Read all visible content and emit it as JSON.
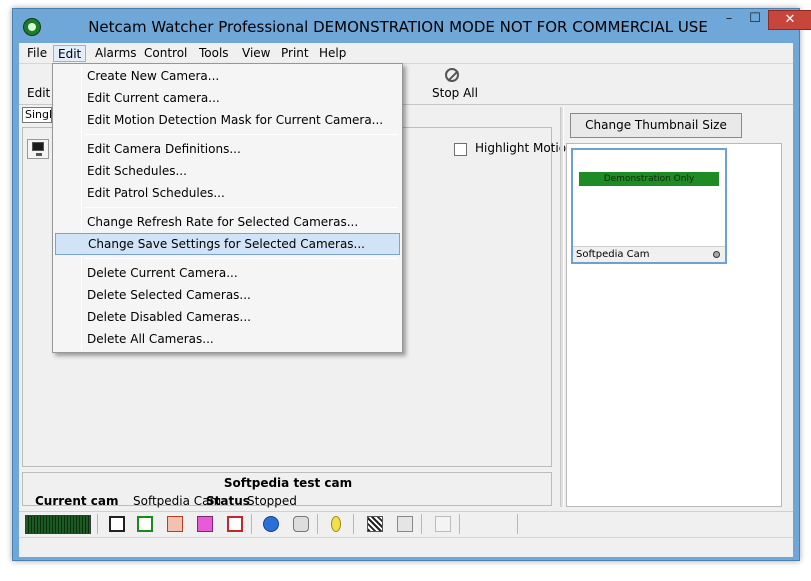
{
  "window": {
    "title": "Netcam Watcher Professional DEMONSTRATION MODE NOT FOR COMMERCIAL USE",
    "min_glyph": "–",
    "max_glyph": "☐",
    "close_glyph": "✕"
  },
  "menubar": {
    "file": "File",
    "edit": "Edit",
    "alarms": "Alarms",
    "control": "Control",
    "tools": "Tools",
    "view": "View",
    "print": "Print",
    "help": "Help"
  },
  "toolbar": {
    "edit_label": "Edit",
    "stop_all_label": "Stop All"
  },
  "left_panel": {
    "single_tab": "Single",
    "highlight_motion": "Highlight Motion",
    "camera_name": "Softpedia test cam",
    "current_cam_label": "Current cam",
    "current_cam_value": "Softpedia Cam",
    "status_label": "Status",
    "status_value": "Stopped"
  },
  "right_panel": {
    "thumbnail_button": "Change Thumbnail Size",
    "demo_banner": "Demonstration Only",
    "thumb_cam_name": "Softpedia Cam"
  },
  "edit_menu": {
    "items": [
      "Create New Camera...",
      "Edit Current camera...",
      "Edit Motion Detection Mask for Current Camera...",
      "Edit Camera Definitions...",
      "Edit Schedules...",
      "Edit Patrol Schedules...",
      "Change Refresh Rate for Selected  Cameras...",
      "Change Save Settings for Selected Cameras...",
      "Delete Current Camera...",
      "Delete Selected Cameras...",
      "Delete Disabled Cameras...",
      "Delete All Cameras..."
    ],
    "highlighted_index": 7
  },
  "colors": {
    "title_bar": "#6fa7d8",
    "close_button": "#c7463b",
    "demo_banner": "#1f8b24",
    "menu_highlight": "#d1e3f6"
  }
}
